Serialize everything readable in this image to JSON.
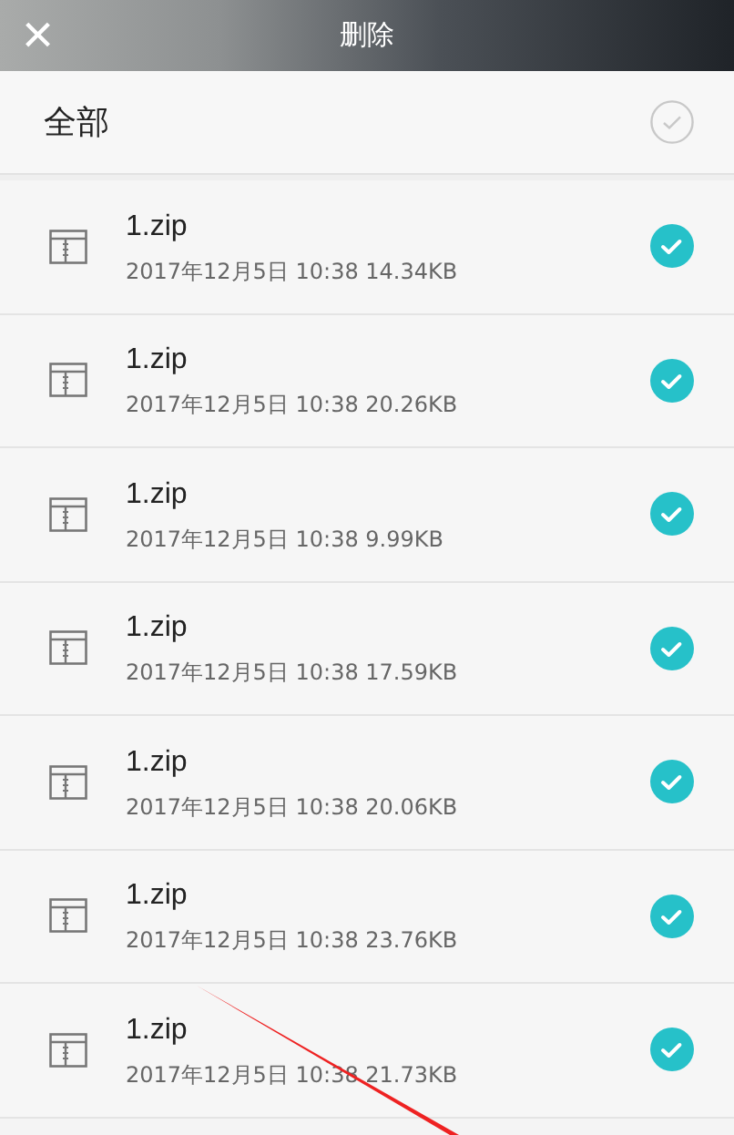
{
  "header": {
    "close": "×",
    "title": "删除"
  },
  "select_all": {
    "label": "全部",
    "checked": false
  },
  "files": [
    {
      "name": "1.zip",
      "details": "2017年12月5日 10:38 14.34KB",
      "checked": true
    },
    {
      "name": "1.zip",
      "details": "2017年12月5日 10:38 20.26KB",
      "checked": true
    },
    {
      "name": "1.zip",
      "details": "2017年12月5日 10:38 9.99KB",
      "checked": true
    },
    {
      "name": "1.zip",
      "details": "2017年12月5日 10:38 17.59KB",
      "checked": true
    },
    {
      "name": "1.zip",
      "details": "2017年12月5日 10:38 20.06KB",
      "checked": true
    },
    {
      "name": "1.zip",
      "details": "2017年12月5日 10:38 23.76KB",
      "checked": true
    },
    {
      "name": "1.zip",
      "details": "2017年12月5日 10:38 21.73KB",
      "checked": true
    }
  ]
}
